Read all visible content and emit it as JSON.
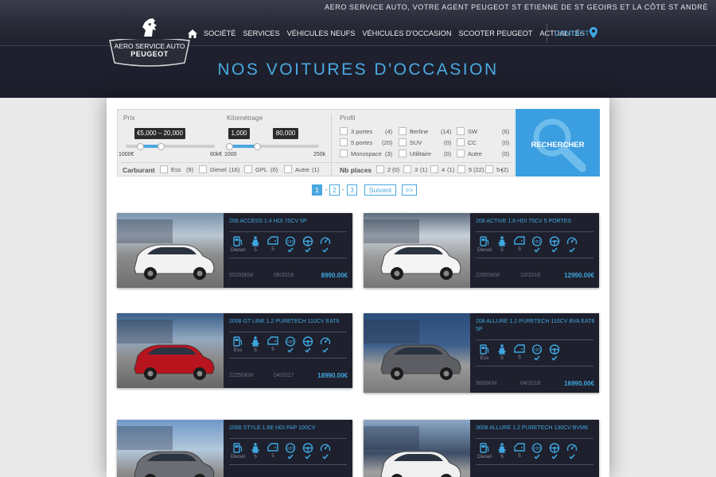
{
  "header": {
    "tagline": "AERO SERVICE AUTO, VOTRE AGENT PEUGEOT ST ETIENNE DE ST GEOIRS ET LA CÔTE ST ANDRÉ",
    "logo_line1": "AERO SERVICE AUTO",
    "logo_line2": "PEUGEOT",
    "nav": [
      "SOCIÉTÉ",
      "SERVICES",
      "VÉHICULES NEUFS",
      "VÉHICULES D'OCCASION",
      "SCOOTER PEUGEOT",
      "ACTUALITÉS"
    ],
    "contact": "CONTACT",
    "page_title": "NOS VOITURES D'OCCASION"
  },
  "filter": {
    "prix": {
      "label": "Prix",
      "value": "€5,000 – 20,000",
      "min": "1000€",
      "max": "60k€",
      "low": 5000,
      "high": 20000,
      "range_min": 1000,
      "range_max": 60000
    },
    "km": {
      "label": "Kilométrage",
      "value_low": "1,000",
      "value_high": "80,000",
      "min": "1000",
      "max": "250k",
      "low": 1000,
      "high": 80000,
      "range_min": 1000,
      "range_max": 250000
    },
    "profil_label": "Profil",
    "profil": [
      {
        "label": "3 portes",
        "count": "(4)"
      },
      {
        "label": "5 portes",
        "count": "(20)"
      },
      {
        "label": "Monospace",
        "count": "(3)"
      },
      {
        "label": "Berline",
        "count": "(14)"
      },
      {
        "label": "SUV",
        "count": "(0)"
      },
      {
        "label": "Utilitaire",
        "count": "(0)"
      },
      {
        "label": "SW",
        "count": "(6)"
      },
      {
        "label": "CC",
        "count": "(0)"
      },
      {
        "label": "Autre",
        "count": "(0)"
      }
    ],
    "carburant_label": "Carburant",
    "carburant": [
      {
        "label": "Ess",
        "count": "(9)"
      },
      {
        "label": "Diesel",
        "count": "(16)"
      },
      {
        "label": "GPL",
        "count": "(0)"
      },
      {
        "label": "Autre",
        "count": "(1)"
      }
    ],
    "places_label": "Nb places",
    "places": [
      {
        "label": "2",
        "count": "(0)"
      },
      {
        "label": "3",
        "count": "(1)"
      },
      {
        "label": "4",
        "count": "(1)"
      },
      {
        "label": "5",
        "count": "(22)"
      },
      {
        "label": "5+",
        "count": "(2)"
      }
    ],
    "search_label": "RECHERCHER"
  },
  "pagination": {
    "pages": [
      "1",
      "2",
      "3"
    ],
    "next": "Suivant",
    "last": ">>",
    "sep": "-"
  },
  "cards": [
    {
      "title": "208 ACCESS 1.4 HDI 70CV 5P",
      "fuel": "Diesel",
      "seats": "5",
      "doors": "5",
      "km": "55200KM",
      "date": "06/2016",
      "price": "8990.00€"
    },
    {
      "title": "208 ACTIVE 1.6 HDI 75CV 5 PORTES",
      "fuel": "Diesel",
      "seats": "5",
      "doors": "5",
      "km": "22900KM",
      "date": "10/2016",
      "price": "12990.00€"
    },
    {
      "title": "2008 GT LINE 1.2 PURETECH 110CV EAT6",
      "fuel": "Ess",
      "seats": "5",
      "doors": "5",
      "km": "22250KM",
      "date": "04/2017",
      "price": "18990.00€"
    },
    {
      "title": "208 ALLURE 1.2 PURETECH 110CV BVA EAT6 5P",
      "fuel": "Ess",
      "seats": "5",
      "doors": "5",
      "km": "9800KM",
      "date": "04/2018",
      "price": "16990.00€"
    },
    {
      "title": "2008 STYLE 1.6E HDI FAP 100CV",
      "fuel": "Diesel",
      "seats": "5",
      "doors": "5",
      "km": "",
      "date": "",
      "price": ""
    },
    {
      "title": "3008 ALLURE 1.2 PURETECH 130CV BVM6",
      "fuel": "Diesel",
      "seats": "5",
      "doors": "5",
      "km": "",
      "date": "",
      "price": ""
    }
  ],
  "colors": {
    "accent": "#3fa7e0",
    "header_bg": "#1f2130",
    "card_bg": "#1e202d"
  }
}
